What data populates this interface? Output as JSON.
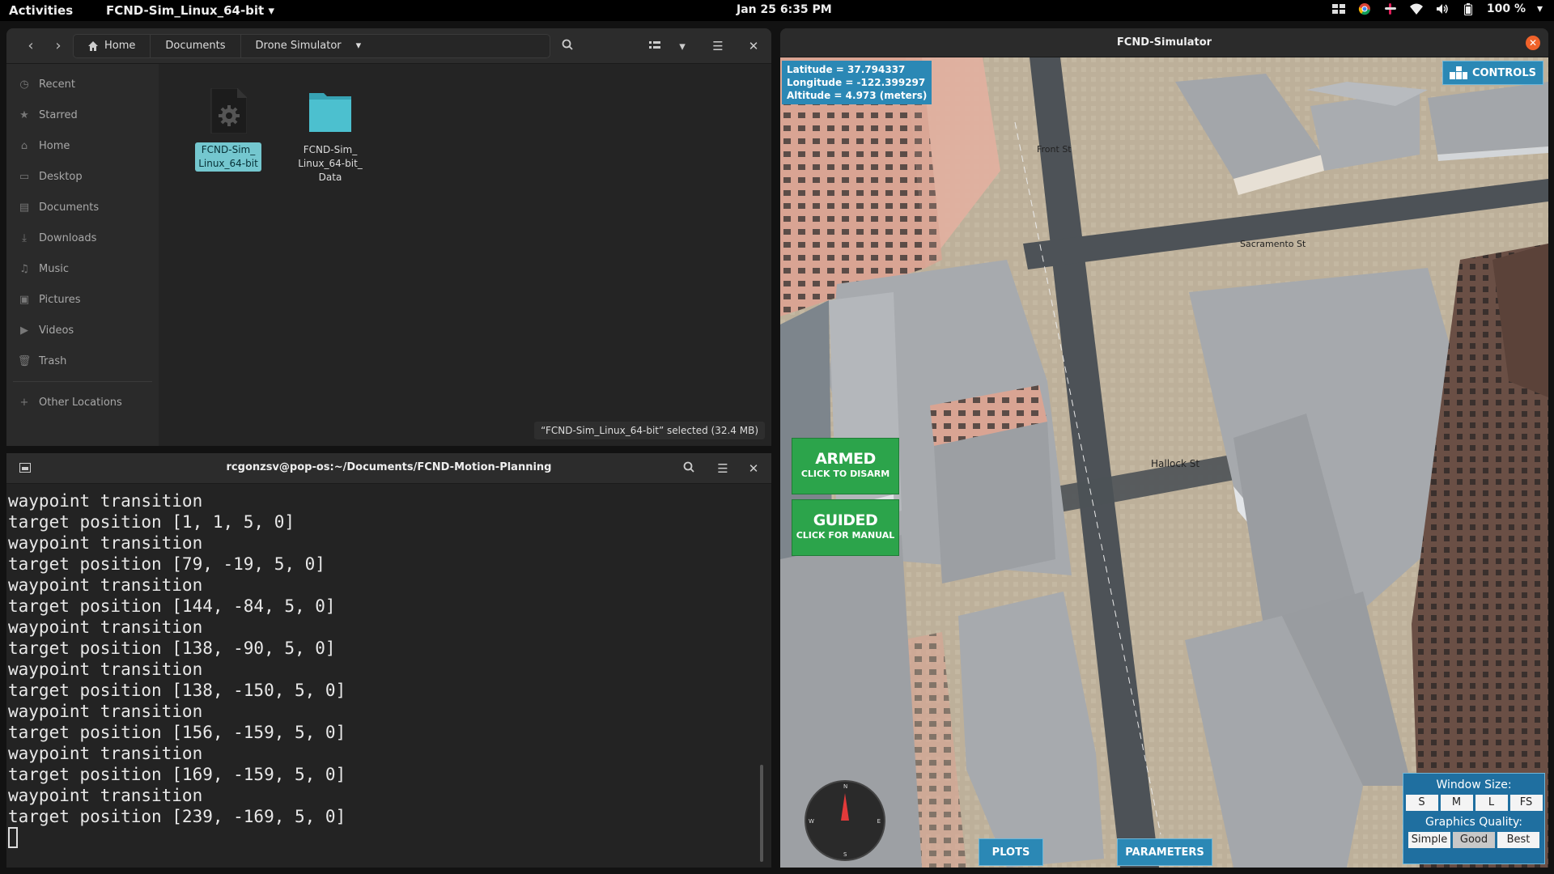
{
  "topbar": {
    "activities": "Activities",
    "app_menu": "FCND-Sim_Linux_64-bit",
    "clock": "Jan 25  6:35 PM",
    "battery": "100 %"
  },
  "file_manager": {
    "breadcrumbs": [
      "Home",
      "Documents",
      "Drone Simulator"
    ],
    "sidebar": [
      {
        "label": "Recent",
        "icon": "clock-icon"
      },
      {
        "label": "Starred",
        "icon": "star-icon"
      },
      {
        "label": "Home",
        "icon": "home-icon"
      },
      {
        "label": "Desktop",
        "icon": "desktop-icon"
      },
      {
        "label": "Documents",
        "icon": "document-icon"
      },
      {
        "label": "Downloads",
        "icon": "download-icon"
      },
      {
        "label": "Music",
        "icon": "music-icon"
      },
      {
        "label": "Pictures",
        "icon": "picture-icon"
      },
      {
        "label": "Videos",
        "icon": "video-icon"
      },
      {
        "label": "Trash",
        "icon": "trash-icon"
      },
      {
        "label": "Other Locations",
        "icon": "plus-icon"
      }
    ],
    "files": [
      {
        "name_line1": "FCND-Sim_",
        "name_line2": "Linux_64-bit",
        "name_line3": "",
        "type": "executable"
      },
      {
        "name_line1": "FCND-Sim_",
        "name_line2": "Linux_64-bit_",
        "name_line3": "Data",
        "type": "folder"
      }
    ],
    "status": "“FCND-Sim_Linux_64-bit” selected  (32.4 MB)"
  },
  "terminal": {
    "title": "rcgonzsv@pop-os:~/Documents/FCND-Motion-Planning",
    "lines": [
      "waypoint transition",
      "target position [1, 1, 5, 0]",
      "waypoint transition",
      "target position [79, -19, 5, 0]",
      "waypoint transition",
      "target position [144, -84, 5, 0]",
      "waypoint transition",
      "target position [138, -90, 5, 0]",
      "waypoint transition",
      "target position [138, -150, 5, 0]",
      "waypoint transition",
      "target position [156, -159, 5, 0]",
      "waypoint transition",
      "target position [169, -159, 5, 0]",
      "waypoint transition",
      "target position [239, -169, 5, 0]"
    ]
  },
  "simulator": {
    "title": "FCND-Simulator",
    "latitude": "Latitude = 37.794337",
    "longitude": "Longitude = -122.399297",
    "altitude": "Altitude = 4.973 (meters)",
    "controls": "CONTROLS",
    "armed": {
      "title": "ARMED",
      "sub": "CLICK TO DISARM"
    },
    "guided": {
      "title": "GUIDED",
      "sub": "CLICK FOR MANUAL"
    },
    "plots": "PLOTS",
    "parameters": "PARAMETERS",
    "streets": [
      "Front St",
      "Sacramento St",
      "Hallock St"
    ],
    "compass": {
      "n": "N",
      "s": "S",
      "e": "E",
      "w": "W"
    },
    "window_size_label": "Window Size:",
    "window_sizes": [
      "S",
      "M",
      "L",
      "FS"
    ],
    "graphics_label": "Graphics Quality:",
    "graphics": [
      "Simple",
      "Good",
      "Best"
    ],
    "graphics_selected": "Good"
  }
}
